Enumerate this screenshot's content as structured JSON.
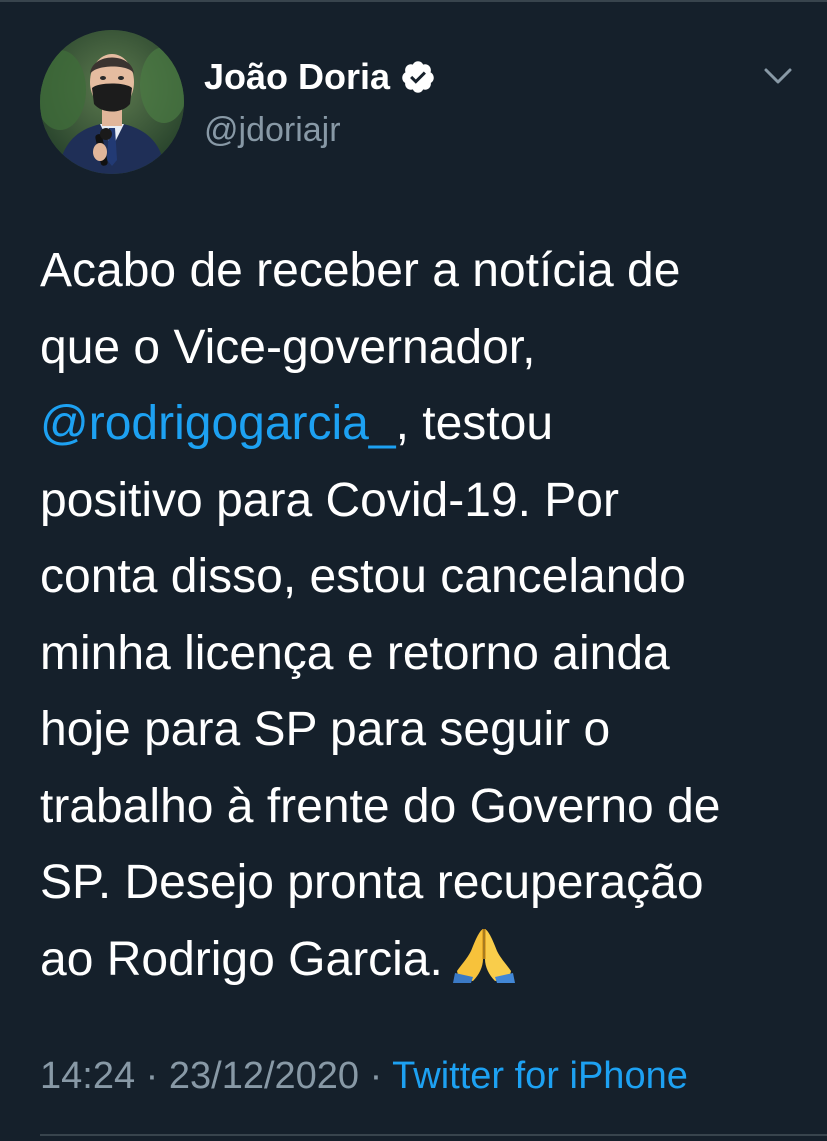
{
  "tweet": {
    "author": {
      "display_name": "João Doria",
      "handle": "@jdoriajr",
      "verified": true,
      "avatar_icon": "profile-photo"
    },
    "text_lines": [
      {
        "text": "Acabo de receber a notícia de"
      },
      {
        "text": "que o Vice-governador,"
      },
      {
        "mention": "@rodrigogarcia_",
        "text": ", testou"
      },
      {
        "text": "positivo para Covid-19. Por"
      },
      {
        "text": "conta disso, estou cancelando"
      },
      {
        "text": "minha licença e retorno ainda"
      },
      {
        "text": "hoje para SP para seguir o"
      },
      {
        "text": "trabalho à frente do Governo de"
      },
      {
        "text": "SP. Desejo pronta recuperação"
      },
      {
        "text": "ao Rodrigo Garcia.",
        "emoji": "folded-hands"
      }
    ],
    "time": "14:24",
    "date": "23/12/2020",
    "separator": "·",
    "source": "Twitter for iPhone"
  },
  "colors": {
    "background": "#15202b",
    "text": "#ffffff",
    "secondary": "#8899a6",
    "accent": "#1da1f2",
    "divider": "#38444d"
  },
  "icons": {
    "verified": "verified-badge-icon",
    "menu": "chevron-down-icon",
    "emoji": "folded-hands-emoji"
  }
}
